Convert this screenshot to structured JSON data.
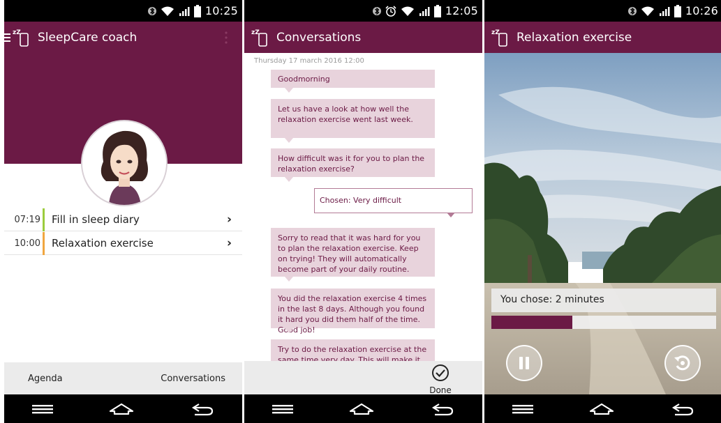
{
  "screens": [
    {
      "status_time": "10:25",
      "app_title": "SleepCare coach",
      "agenda": [
        {
          "time": "07:19",
          "label": "Fill in sleep diary",
          "accent": "#9ccc3d"
        },
        {
          "time": "10:00",
          "label": "Relaxation exercise",
          "accent": "#f0a640"
        }
      ],
      "tabs": {
        "left": "Agenda",
        "right": "Conversations"
      }
    },
    {
      "status_time": "12:05",
      "app_title": "Conversations",
      "date": "Thursday 17 march 2016 12:00",
      "messages": [
        "Goodmorning",
        "Let us have a look at how well the relaxation exercise went last week.",
        "How difficult was it for you to plan the relaxation exercise?",
        "Sorry to read that it was hard for you to plan the relaxation exercise. Keep on trying! They will automatically become part of your daily routine.",
        "You did the relaxation exercise 4 times in the last 8 days. Although you found it hard you did them half of the time. Good job!",
        "Try to do the relaxation exercise at the same time very day. This will make it"
      ],
      "chosen": "Chosen: Very difficult",
      "done_label": "Done"
    },
    {
      "status_time": "10:26",
      "app_title": "Relaxation exercise",
      "chosen_text": "You chose: 2 minutes",
      "progress": 0.36
    }
  ],
  "colors": {
    "brand": "#6b1a45",
    "bubble": "#e8d3dc",
    "bar_bg": "#ebebeb"
  },
  "icons": [
    "menu-icon",
    "sleep-phone-logo-icon",
    "overflow-menu-icon",
    "bluetooth-icon",
    "alarm-icon",
    "wifi-icon",
    "signal-icon",
    "battery-icon",
    "chevron-right-icon",
    "check-circle-icon",
    "pause-icon",
    "replay-icon",
    "recent-apps-icon",
    "home-icon",
    "back-icon"
  ]
}
